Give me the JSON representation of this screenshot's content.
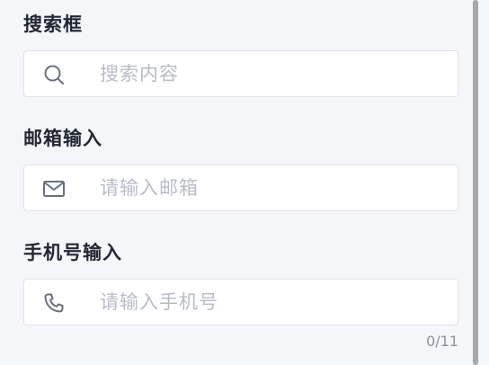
{
  "search": {
    "label": "搜索框",
    "placeholder": "搜索内容",
    "value": "",
    "icon": "search-icon"
  },
  "email": {
    "label": "邮箱输入",
    "placeholder": "请输入邮箱",
    "value": "",
    "icon": "mail-icon"
  },
  "phone": {
    "label": "手机号输入",
    "placeholder": "请输入手机号",
    "value": "",
    "icon": "phone-icon",
    "counter": "0/11"
  },
  "colors": {
    "background": "#f5f6fa",
    "input_border": "#e1e3e8",
    "label_text": "#222833",
    "placeholder_text": "#b7bcc6",
    "icon": "#6b717c",
    "scrollbar": "#a6a8ad"
  }
}
